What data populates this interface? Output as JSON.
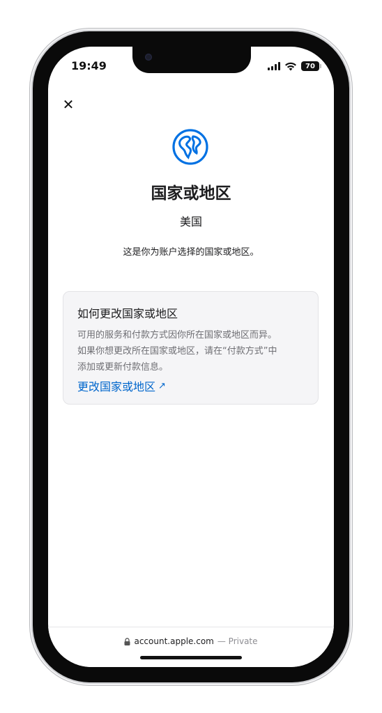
{
  "status_bar": {
    "time": "19:49",
    "battery": "70"
  },
  "header": {
    "close_icon": "✕"
  },
  "page": {
    "icon": "globe-icon",
    "title": "国家或地区",
    "country": "美国",
    "description": "这是你为账户选择的国家或地区。"
  },
  "info_card": {
    "title": "如何更改国家或地区",
    "body_lines": [
      "可用的服务和付款方式因你所在国家或地区而异。",
      "如果你想更改所在国家或地区，请在“付款方式”中",
      "添加或更新付款信息。"
    ],
    "link_label": "更改国家或地区",
    "link_arrow": "↗"
  },
  "address_bar": {
    "domain": "account.apple.com",
    "suffix": "— Private"
  },
  "colors": {
    "accent": "#0066cc",
    "globe": "#0071e3",
    "card_bg": "#f5f5f7"
  }
}
